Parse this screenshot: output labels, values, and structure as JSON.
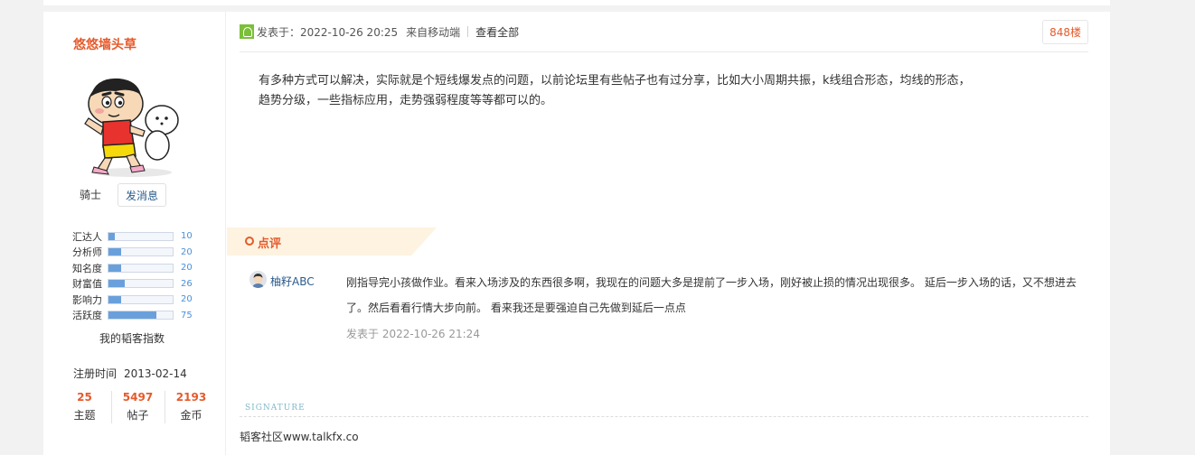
{
  "author": {
    "username": "悠悠墙头草",
    "rank": "骑士",
    "message_button": "发消息",
    "stats": [
      {
        "label": "汇达人",
        "value": "10",
        "fraction": 0.1
      },
      {
        "label": "分析师",
        "value": "20",
        "fraction": 0.2
      },
      {
        "label": "知名度",
        "value": "20",
        "fraction": 0.2
      },
      {
        "label": "财富值",
        "value": "26",
        "fraction": 0.26
      },
      {
        "label": "影响力",
        "value": "20",
        "fraction": 0.2
      },
      {
        "label": "活跃度",
        "value": "75",
        "fraction": 0.75
      }
    ],
    "index_label": "我的韬客指数",
    "register_label": "注册时间",
    "register_date": "2013-02-14",
    "counts": [
      {
        "num": "25",
        "label": "主题"
      },
      {
        "num": "5497",
        "label": "帖子"
      },
      {
        "num": "2193",
        "label": "金币"
      }
    ]
  },
  "post": {
    "posted_label": "发表于：2022-10-26 20:25",
    "source": "来自移动端",
    "view_all": "查看全部",
    "floor": "848楼",
    "body": "有多种方式可以解决，实际就是个短线爆发点的问题，以前论坛里有些帖子也有过分享，比如大小周期共振，k线组合形态，均线的形态，趋势分级，一些指标应用，走势强弱程度等等都可以的。"
  },
  "review": {
    "title": "点评",
    "comment": {
      "user": "柚籽ABC",
      "text": "刚指导完小孩做作业。看来入场涉及的东西很多啊，我现在的问题大多是提前了一步入场，刚好被止损的情况出现很多。 延后一步入场的话，又不想进去了。然后看看行情大步向前。 看来我还是要强迫自己先做到延后一点点",
      "time": "发表于 2022-10-26 21:24"
    }
  },
  "signature": {
    "label": "SIGNATURE",
    "text": "韬客社区www.talkfx.co"
  },
  "colors": {
    "accent": "#e55a2b",
    "link": "#2b5b8c",
    "bar_fill": "#69a0dc"
  }
}
